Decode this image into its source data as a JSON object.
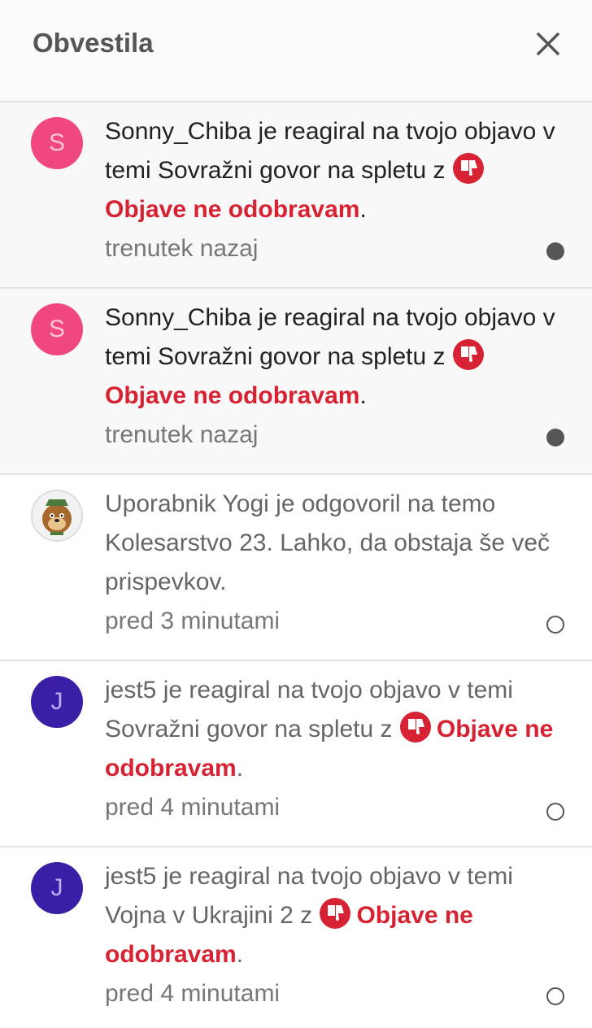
{
  "header": {
    "title": "Obvestila"
  },
  "reaction_label": "Objave ne odobravam",
  "items": [
    {
      "avatar_letter": "S",
      "text": "Sonny_Chiba je reagiral na tvojo objavo v temi Sovražni govor na spletu z",
      "reaction": "Objave ne odobravam",
      "time": "trenutek nazaj",
      "status": "unread"
    },
    {
      "avatar_letter": "S",
      "text": "Sonny_Chiba je reagiral na tvojo objavo v temi Sovražni govor na spletu z",
      "reaction": "Objave ne odobravam",
      "time": "trenutek nazaj",
      "status": "unread"
    },
    {
      "avatar_letter": "",
      "text": "Uporabnik Yogi je odgovoril na temo Kolesarstvo 23. Lahko, da obstaja še več prispevkov.",
      "time": "pred 3 minutami",
      "status": "read"
    },
    {
      "avatar_letter": "J",
      "text": "jest5 je reagiral na tvojo objavo v temi Sovražni govor na spletu z",
      "reaction": "Objave ne odobravam",
      "time": "pred 4 minutami",
      "status": "read"
    },
    {
      "avatar_letter": "J",
      "text": "jest5 je reagiral na tvojo objavo v temi Vojna v Ukrajini 2 z",
      "reaction": "Objave ne odobravam",
      "time": "pred 4 minutami",
      "status": "read"
    }
  ],
  "colors": {
    "avatar_pink": "#f0477e",
    "avatar_purple": "#3a1fa6",
    "reaction_red": "#d62233"
  }
}
